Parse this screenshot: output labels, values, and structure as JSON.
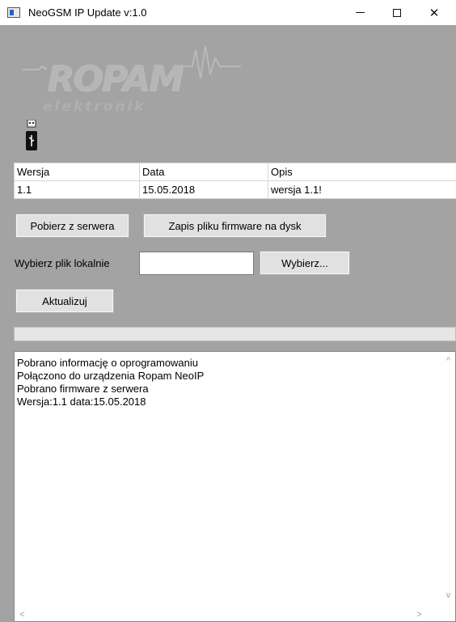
{
  "window": {
    "title": "NeoGSM IP Update v:1.0",
    "minimize_icon": "minimize-icon",
    "maximize_icon": "maximize-icon",
    "close_glyph": "✕"
  },
  "logo": {
    "main": "ROPAM",
    "sub": "elektronik"
  },
  "usb": {
    "icon": "usb-icon"
  },
  "table": {
    "columns": [
      "Wersja",
      "Data",
      "Opis"
    ],
    "rows": [
      [
        "1.1",
        "15.05.2018",
        "wersja 1.1!"
      ]
    ]
  },
  "buttons": {
    "fetch": "Pobierz z serwera",
    "save_firmware": "Zapis pliku firmware na dysk",
    "choose": "Wybierz...",
    "update": "Aktualizuj"
  },
  "local_file": {
    "label": "Wybierz plik lokalnie",
    "value": "",
    "placeholder": ""
  },
  "progress": {
    "value": 0
  },
  "log": {
    "lines": [
      "Pobrano informację o oprogramowaniu",
      "Połączono do urządzenia Ropam NeoIP",
      "Pobrano firmware z serwera",
      "Wersja:1.1 data:15.05.2018"
    ],
    "scroll_up": "^",
    "scroll_down": "v",
    "scroll_left": "<",
    "scroll_right": ">"
  },
  "colors": {
    "panel_bg": "#a3a3a3",
    "button_bg": "#e1e1e1",
    "logo_gray": "#b6b6b6"
  }
}
